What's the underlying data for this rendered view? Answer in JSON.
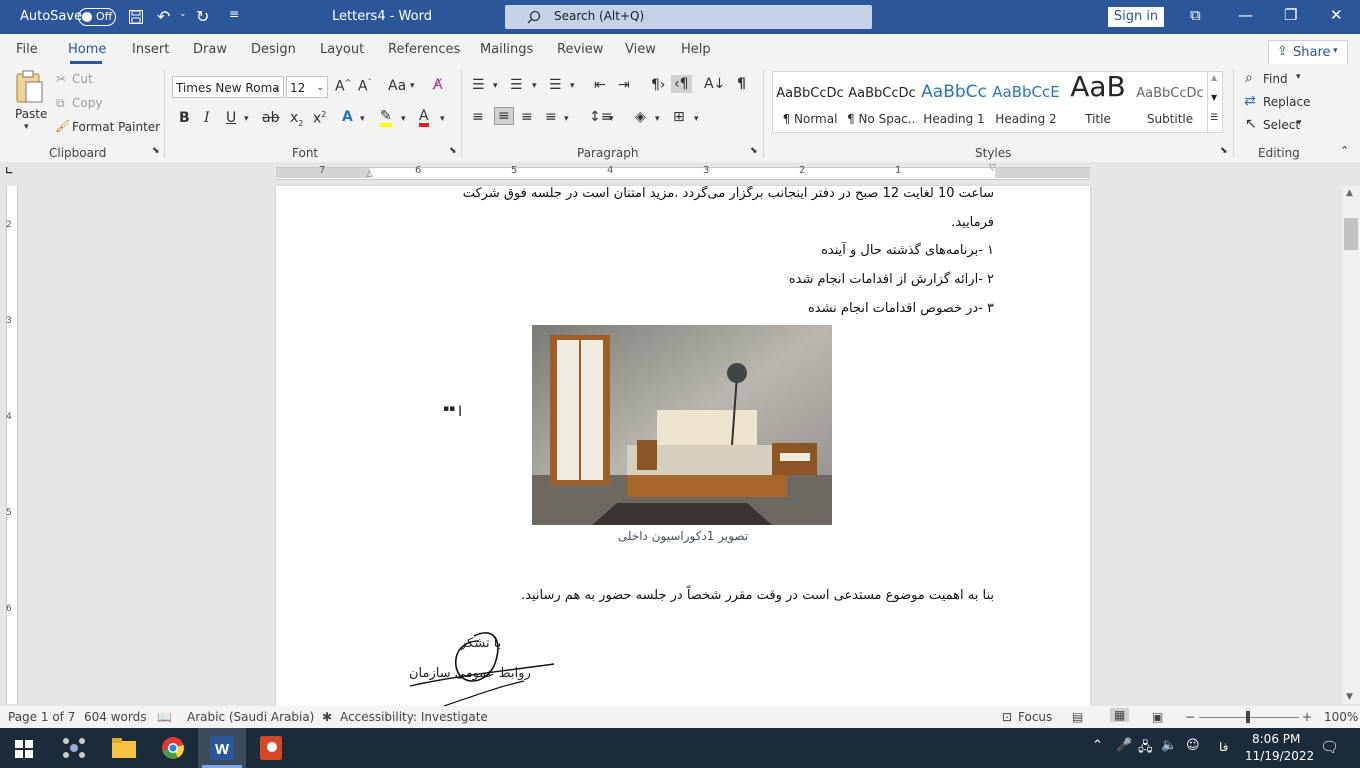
{
  "titlebar": {
    "autosave_label": "AutoSave",
    "autosave_state": "Off",
    "doc_title": "Letters4 - Word",
    "search_placeholder": "Search (Alt+Q)",
    "signin_label": "Sign in"
  },
  "menu": {
    "tabs": [
      "File",
      "Home",
      "Insert",
      "Draw",
      "Design",
      "Layout",
      "References",
      "Mailings",
      "Review",
      "View",
      "Help"
    ],
    "active": "Home",
    "share_label": "Share"
  },
  "ribbon": {
    "clipboard": {
      "paste": "Paste",
      "cut": "Cut",
      "copy": "Copy",
      "format_painter": "Format Painter",
      "group_label": "Clipboard"
    },
    "font": {
      "font_name": "Times New Roma",
      "font_size": "12",
      "group_label": "Font"
    },
    "paragraph": {
      "group_label": "Paragraph"
    },
    "styles": {
      "group_label": "Styles",
      "items": [
        {
          "preview": "AaBbCcDc",
          "name": "¶ Normal"
        },
        {
          "preview": "AaBbCcDc",
          "name": "¶ No Spac..."
        },
        {
          "preview": "AaBbCc",
          "name": "Heading 1"
        },
        {
          "preview": "AaBbCcE",
          "name": "Heading 2"
        },
        {
          "preview": "AaB",
          "name": "Title"
        },
        {
          "preview": "AaBbCcDc",
          "name": "Subtitle"
        }
      ]
    },
    "editing": {
      "find": "Find",
      "replace": "Replace",
      "select": "Select",
      "group_label": "Editing"
    }
  },
  "ruler": {
    "numbers": [
      "7",
      "6",
      "5",
      "4",
      "3",
      "2",
      "1"
    ],
    "vertical_numbers": [
      "2",
      "3",
      "4",
      "5",
      "6"
    ]
  },
  "document": {
    "line1": "ساعت 10 لغایت 12 صبح در دفتر اینجانب برگزار می‌گردد .مزید امتنان است در جلسه فوق شرکت",
    "line2": "فرمایید.",
    "item1": "۱ -برنامه‌های گذشته حال و آینده",
    "item2": "۲ -ارائه گزارش از اقدامات انجام شده",
    "item3": "۳ -در خصوص اقدامات انجام نشده",
    "caption": "تصویر 1دکوراسیون داخلی",
    "closing": "بنا به اهمیت موضوع مستدعی است در وقت مقرر شخصاً در جلسه حضور به هم رسانید.",
    "thanks": "با تشکر",
    "signer": "روابط عمومی سازمان"
  },
  "statusbar": {
    "page": "Page 1 of 7",
    "words": "604 words",
    "language": "Arabic (Saudi Arabia)",
    "accessibility": "Accessibility: Investigate",
    "focus": "Focus",
    "zoom": "100%"
  },
  "taskbar": {
    "time": "8:06 PM",
    "date": "11/19/2022",
    "lang": "فا"
  },
  "colors": {
    "word_blue": "#2b579a",
    "taskbar": "#1c2b3a"
  }
}
